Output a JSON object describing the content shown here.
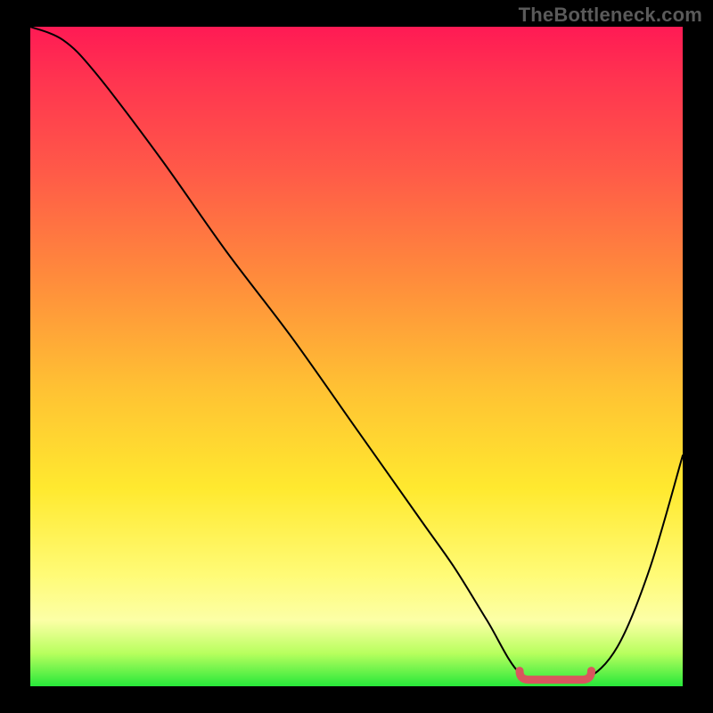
{
  "watermark": "TheBottleneck.com",
  "colors": {
    "background": "#000000",
    "gradient_top": "#ff1a54",
    "gradient_mid1": "#ff8b3c",
    "gradient_mid2": "#ffe92f",
    "gradient_bottom": "#27e83a",
    "curve": "#000000",
    "valley_marker": "#d9565e"
  },
  "chart_data": {
    "type": "line",
    "title": "",
    "xlabel": "",
    "ylabel": "",
    "xlim": [
      0,
      100
    ],
    "ylim": [
      0,
      100
    ],
    "x": [
      0,
      5,
      10,
      20,
      30,
      40,
      50,
      60,
      65,
      70,
      75,
      80,
      85,
      90,
      95,
      100
    ],
    "values": [
      100,
      98,
      93,
      80,
      66,
      53,
      39,
      25,
      18,
      10,
      2,
      1,
      1,
      6,
      18,
      35
    ],
    "valley_range_x": [
      75,
      86
    ],
    "valley_y": 1,
    "annotations": []
  }
}
